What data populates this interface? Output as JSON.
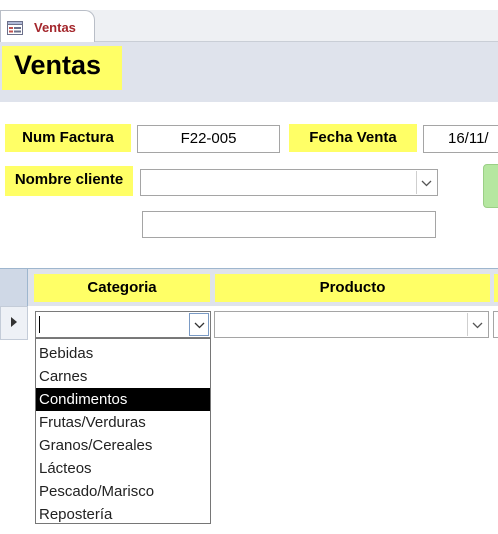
{
  "tab": {
    "label": "Ventas",
    "icon": "form-icon"
  },
  "header": {
    "title": "Ventas"
  },
  "form": {
    "num_factura_label": "Num Factura",
    "num_factura_value": "F22-005",
    "fecha_venta_label": "Fecha Venta",
    "fecha_venta_value": "16/11/",
    "nombre_cliente_label": "Nombre cliente",
    "nombre_cliente_value": "",
    "cliente_extra_value": ""
  },
  "grid": {
    "columns": [
      "Categoria",
      "Producto"
    ],
    "row": {
      "categoria_value": "",
      "producto_value": ""
    }
  },
  "dropdown": {
    "options": [
      "Bebidas",
      "Carnes",
      "Condimentos",
      "Frutas/Verduras",
      "Granos/Cereales",
      "Lácteos",
      "Pescado/Marisco",
      "Repostería"
    ],
    "highlighted": "Condimentos"
  },
  "colors": {
    "label_bg": "#ffff66",
    "header_bg": "#dfe3ec",
    "tab_text": "#a4262c",
    "button_green": "#b5e7a0",
    "selected_bg": "#000000"
  }
}
